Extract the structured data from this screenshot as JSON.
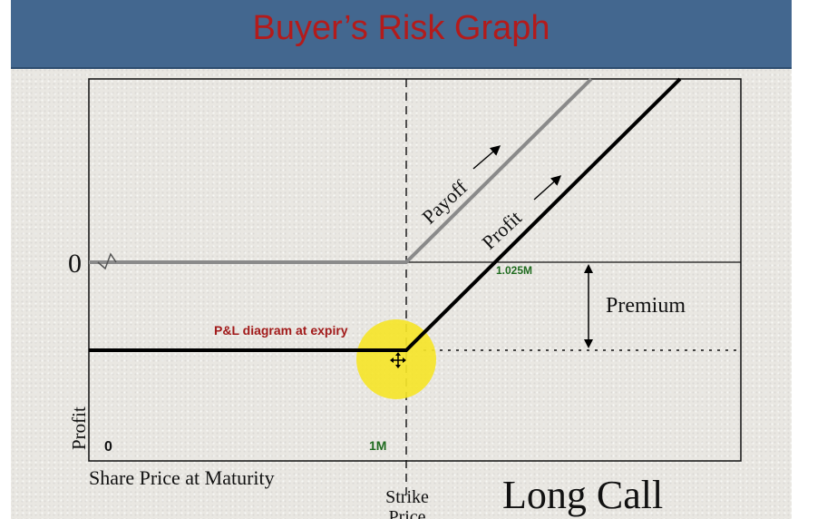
{
  "header": {
    "title": "Buyer’s Risk Graph"
  },
  "graph": {
    "zero_label": "0",
    "origin_label": "0",
    "strike_value_label": "1M",
    "breakeven_label": "1.025M",
    "payoff_label": "Payoff",
    "profit_line_label": "Profit",
    "premium_label": "Premium",
    "pl_annotation": "P&L diagram at expiry",
    "y_axis_label": "Profit",
    "x_axis_label": "Share Price at Maturity",
    "strike_label_line1": "Strike",
    "strike_label_line2": "Price",
    "strategy_label": "Long Call"
  },
  "colors": {
    "title": "#b31b1b",
    "header_bg": "#43678f",
    "payoff_line": "#8a8a8a",
    "profit_line": "#000000",
    "annotation": "#a11a1a",
    "value_labels": "#1f6b1f",
    "cursor_highlight": "#f5e52a"
  }
}
